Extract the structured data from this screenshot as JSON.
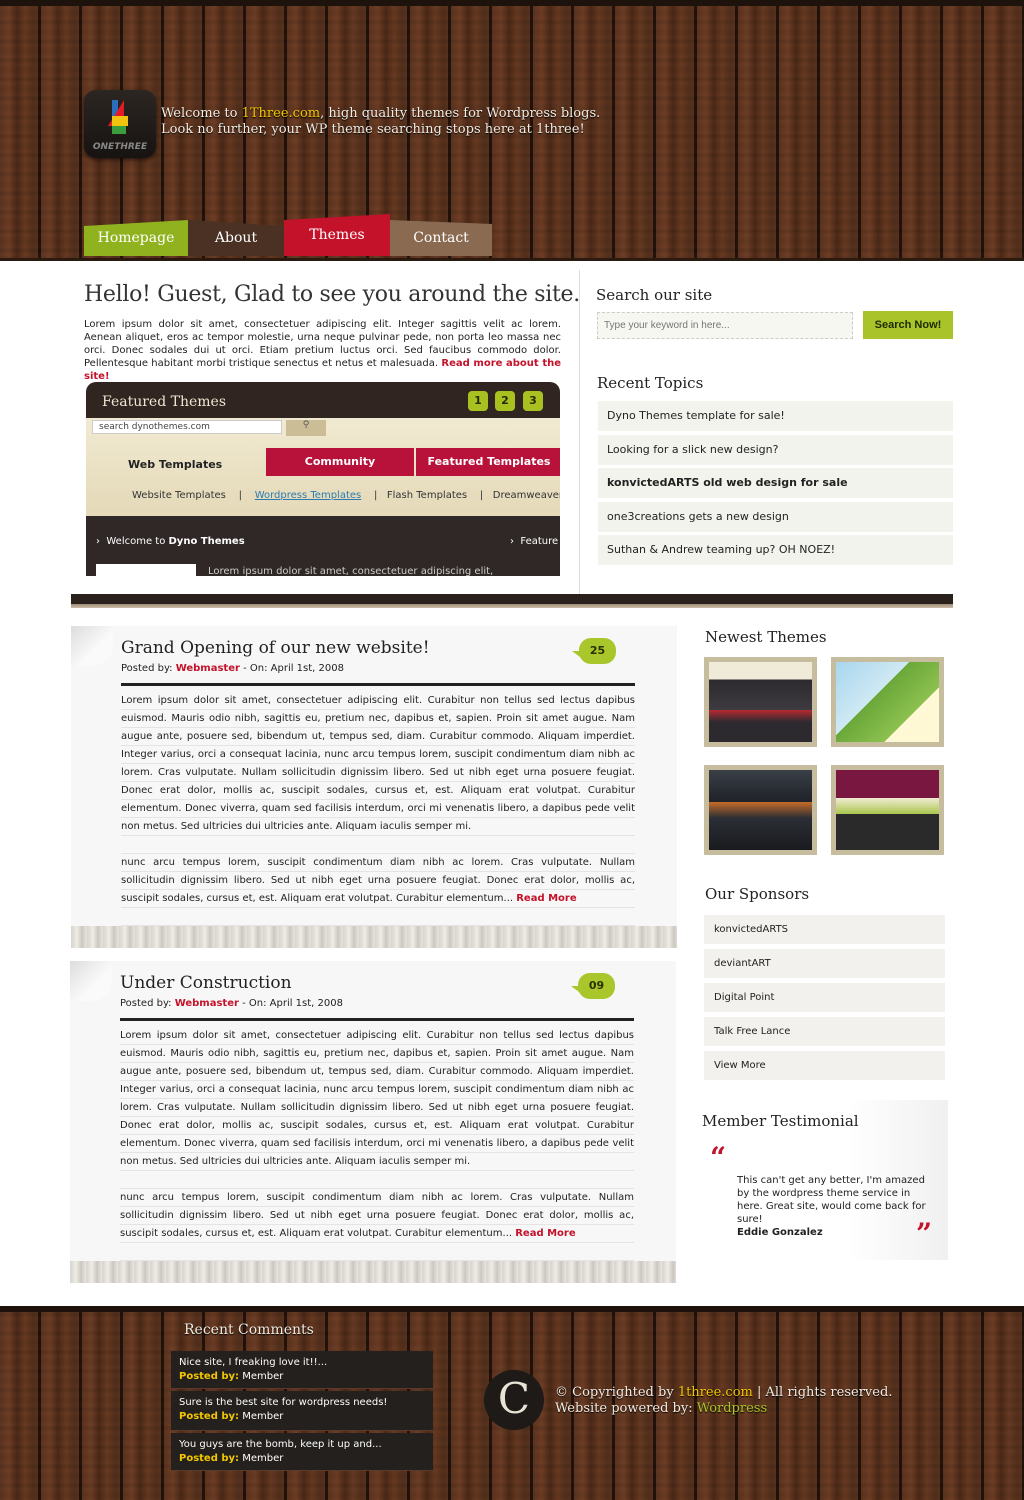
{
  "header": {
    "logo_text": "ONETHREE",
    "welcome_prefix": "Welcome to ",
    "welcome_site": "1Three.com",
    "welcome_suffix": ", high quality themes for Wordpress blogs.",
    "welcome_line2": "Look no further, your WP theme searching stops here at 1three!"
  },
  "nav": {
    "items": [
      {
        "label": "Homepage",
        "color": "#8fb21e"
      },
      {
        "label": "About",
        "color": "#4a3123"
      },
      {
        "label": "Themes",
        "color": "#c4122a"
      },
      {
        "label": "Contact",
        "color": "#8a6b51"
      }
    ]
  },
  "intro": {
    "title": "Hello! Guest, Glad to see you around the site.",
    "text": "Lorem ipsum dolor sit amet, consectetuer adipiscing elit. Integer sagittis velit ac lorem. Aenean aliquet, eros ac tempor molestie, urna neque pulvinar pede, non porta leo massa nec orci. Donec sodales dui ut orci. Etiam pretium luctus orci. Sed faucibus commodo dolor. Pellentesque habitant morbi tristique senectus et netus et malesuada. ",
    "read_more": "Read more about the site!"
  },
  "featured": {
    "title": "Featured Themes",
    "pages": [
      "1",
      "2",
      "3"
    ],
    "search_value": "search dynothemes.com",
    "web_templates": "Web Templates",
    "community": "Community",
    "featured_templates": "Featured Templates",
    "sub_a": "Website Templates",
    "sep": "|",
    "sub_b": "Wordpress Templates",
    "sub_c": "Flash Templates",
    "sub_d": "Dreamweaver T",
    "welcome_prefix": "Welcome to ",
    "welcome_name": "Dyno Themes",
    "feature_cut": "Feature",
    "lorem_cut": "Lorem ipsum dolor sit amet, consectetuer adipiscing elit,",
    "arrow": "›"
  },
  "search": {
    "heading": "Search our site",
    "placeholder": "Type your keyword in here...",
    "button": "Search Now!"
  },
  "recent_topics": {
    "heading": "Recent Topics",
    "items": [
      "Dyno Themes template for sale!",
      "Looking for a slick new design?",
      "konvictedARTS old web design for sale",
      "one3creations gets a new design",
      "Suthan & Andrew teaming up? OH NOEZ!"
    ]
  },
  "posts": [
    {
      "title": "Grand Opening of our new website!",
      "posted_by": "Posted by: ",
      "author": "Webmaster",
      "date": " - On: April 1st, 2008",
      "comments": "25",
      "p1": "Lorem ipsum dolor sit amet, consectetuer adipiscing elit. Curabitur non tellus sed lectus dapibus euismod. Mauris odio nibh, sagittis eu, pretium nec, dapibus et, sapien. Proin sit amet augue. Nam augue ante, posuere sed, bibendum ut, tempus sed, diam. Curabitur commodo. Aliquam imperdiet. Integer varius, orci a consequat lacinia, nunc arcu tempus lorem, suscipit condimentum diam nibh ac lorem. Cras vulputate. Nullam sollicitudin dignissim libero. Sed ut nibh eget urna posuere feugiat. Donec erat dolor, mollis ac, suscipit sodales, cursus et, est. Aliquam erat volutpat. Curabitur elementum. Donec viverra, quam sed facilisis interdum, orci mi venenatis libero, a dapibus pede velit non metus. Sed ultricies dui ultricies ante. Aliquam iaculis semper mi.",
      "p2": "nunc arcu tempus lorem, suscipit condimentum diam nibh ac lorem. Cras vulputate. Nullam sollicitudin dignissim libero. Sed ut nibh eget urna posuere feugiat. Donec erat dolor, mollis ac, suscipit sodales, cursus et, est. Aliquam erat volutpat. Curabitur elementum... ",
      "read_more": "Read More"
    },
    {
      "title": "Under Construction",
      "posted_by": "Posted by: ",
      "author": "Webmaster",
      "date": " - On: April 1st, 2008",
      "comments": "09",
      "p1": "Lorem ipsum dolor sit amet, consectetuer adipiscing elit. Curabitur non tellus sed lectus dapibus euismod. Mauris odio nibh, sagittis eu, pretium nec, dapibus et, sapien. Proin sit amet augue. Nam augue ante, posuere sed, bibendum ut, tempus sed, diam. Curabitur commodo. Aliquam imperdiet. Integer varius, orci a consequat lacinia, nunc arcu tempus lorem, suscipit condimentum diam nibh ac lorem. Cras vulputate. Nullam sollicitudin dignissim libero. Sed ut nibh eget urna posuere feugiat. Donec erat dolor, mollis ac, suscipit sodales, cursus et, est. Aliquam erat volutpat. Curabitur elementum. Donec viverra, quam sed facilisis interdum, orci mi venenatis libero, a dapibus pede velit non metus. Sed ultricies dui ultricies ante. Aliquam iaculis semper mi.",
      "p2": "nunc arcu tempus lorem, suscipit condimentum diam nibh ac lorem. Cras vulputate. Nullam sollicitudin dignissim libero. Sed ut nibh eget urna posuere feugiat. Donec erat dolor, mollis ac, suscipit sodales, cursus et, est. Aliquam erat volutpat. Curabitur elementum... ",
      "read_more": "Read More"
    }
  ],
  "newest_themes": {
    "heading": "Newest Themes"
  },
  "sponsors": {
    "heading": "Our Sponsors",
    "items": [
      "konvictedARTS",
      "deviantART",
      "Digital Point",
      "Talk Free Lance",
      "View More"
    ]
  },
  "testimonial": {
    "heading": "Member Testimonial",
    "open_quote": "“",
    "close_quote": "”",
    "text": "This can't get any better, I'm amazed by the wordpress theme service in here. Great site, would come back for sure!",
    "name": "Eddie Gonzalez"
  },
  "recent_comments": {
    "heading": "Recent Comments",
    "items": [
      {
        "text": "Nice site, I freaking love it!!...",
        "label": "Posted by:",
        "by": " Member"
      },
      {
        "text": "Sure is the best site for wordpress needs!",
        "label": "Posted by:",
        "by": " Member"
      },
      {
        "text": "You guys are the bomb, keep it up and...",
        "label": "Posted by:",
        "by": " Member"
      }
    ]
  },
  "footer": {
    "c_symbol": "C",
    "copy_prefix": "© Copyrighted by ",
    "copy_site": "1three.com",
    "copy_suffix": " | All rights reserved.",
    "powered_prefix": "Website powered by: ",
    "powered_link": "Wordpress"
  },
  "colors": {
    "accent_green": "#a8c42a",
    "accent_red": "#c4122a",
    "wood": "#5d3420",
    "highlight": "#f2c700"
  }
}
